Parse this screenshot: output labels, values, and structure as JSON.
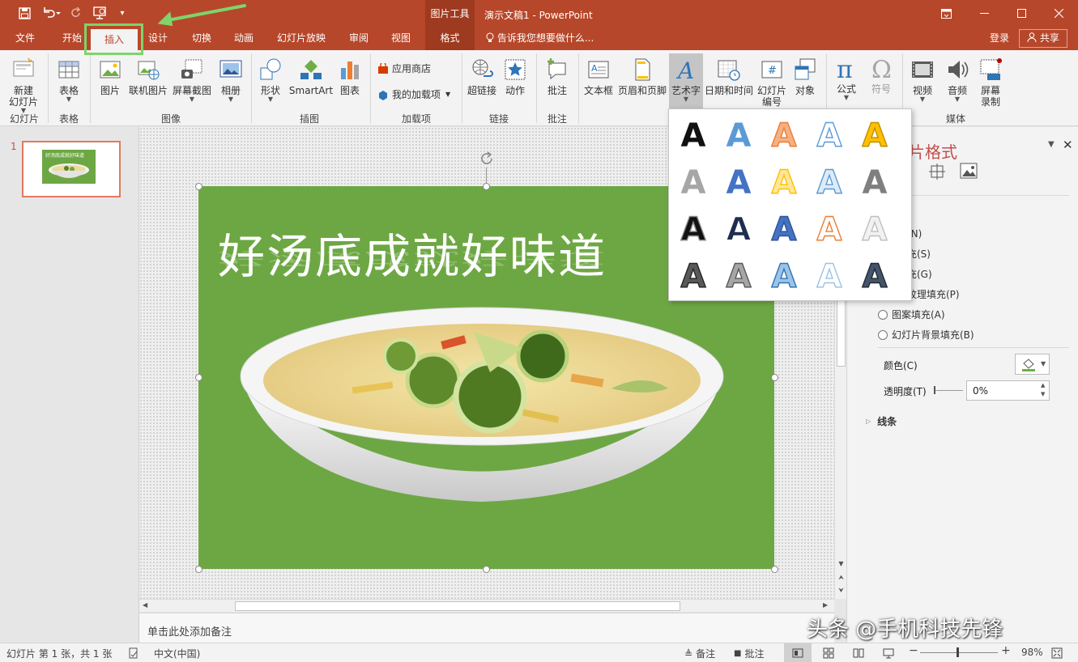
{
  "app": {
    "window_title": "演示文稿1 - PowerPoint",
    "context_tools_header": "图片工具"
  },
  "tabs": [
    {
      "label": "文件"
    },
    {
      "label": "开始"
    },
    {
      "label": "插入"
    },
    {
      "label": "设计"
    },
    {
      "label": "切换"
    },
    {
      "label": "动画"
    },
    {
      "label": "幻灯片放映"
    },
    {
      "label": "审阅"
    },
    {
      "label": "视图"
    },
    {
      "label": "格式"
    }
  ],
  "tellme": "告诉我您想要做什么...",
  "account": {
    "login": "登录",
    "share": "共享"
  },
  "ribbon": {
    "new_slide": "新建\n幻灯片",
    "table": "表格",
    "picture": "图片",
    "online_picture": "联机图片",
    "screenshot": "屏幕截图",
    "album": "相册",
    "shapes": "形状",
    "smartart": "SmartArt",
    "chart": "图表",
    "app_store": "应用商店",
    "my_addins": "我的加载项",
    "hyperlink": "超链接",
    "action": "动作",
    "comment": "批注",
    "textbox": "文本框",
    "header_footer": "页眉和页脚",
    "wordart": "艺术字",
    "datetime": "日期和时间",
    "slide_number": "幻灯片\n编号",
    "object": "对象",
    "equation": "公式",
    "symbol": "符号",
    "video": "视频",
    "audio": "音频",
    "screen_record": "屏幕\n录制",
    "groups": {
      "slides": "幻灯片",
      "tables": "表格",
      "images": "图像",
      "illustrations": "插图",
      "addins": "加载项",
      "links": "链接",
      "comments": "批注",
      "media": "媒体"
    }
  },
  "slide_pane": {
    "number": "1",
    "thumb_title": "好汤底成就好味道"
  },
  "slide": {
    "title": "好汤底成就好味道"
  },
  "notes_placeholder": "单击此处添加备注",
  "format_pane": {
    "title": "片格式",
    "fill_options": [
      "充(N)",
      "填充(S)",
      "填充(G)",
      "或纹理填充(P)",
      "图案填充(A)",
      "幻灯片背景填充(B)"
    ],
    "color_label": "颜色(C)",
    "transparency_label": "透明度(T)",
    "transparency_value": "0%",
    "line_section": "线条"
  },
  "wordart_gallery": {
    "glyph": "A",
    "styles": [
      {
        "fill": "#111111",
        "stroke": "none"
      },
      {
        "fill": "#5b9bd5",
        "stroke": "none"
      },
      {
        "fill": "#f4b183",
        "stroke": "#ed7d31"
      },
      {
        "fill": "#ffffff",
        "stroke": "#5b9bd5"
      },
      {
        "fill": "#ffc000",
        "stroke": "#bf9000"
      },
      {
        "fill": "#a6a6a6",
        "stroke": "none"
      },
      {
        "fill": "#4472c4",
        "stroke": "none"
      },
      {
        "fill": "#ffe699",
        "stroke": "#ffc000"
      },
      {
        "fill": "#deebf7",
        "stroke": "#5b9bd5"
      },
      {
        "fill": "#7f7f7f",
        "stroke": "none"
      },
      {
        "fill": "#111111",
        "stroke": "#888888"
      },
      {
        "fill": "#1f2d4e",
        "stroke": "#ffffff"
      },
      {
        "fill": "#4472c4",
        "stroke": "#2f5597"
      },
      {
        "fill": "#ffffff",
        "stroke": "#ed7d31"
      },
      {
        "fill": "#f2f2f2",
        "stroke": "#bfbfbf"
      },
      {
        "fill": "#595959",
        "stroke": "#262626"
      },
      {
        "fill": "#a6a6a6",
        "stroke": "#595959"
      },
      {
        "fill": "#9dc3e6",
        "stroke": "#2e75b6"
      },
      {
        "fill": "#ffffff",
        "stroke": "#9dc3e6"
      },
      {
        "fill": "#44546a",
        "stroke": "#222a35"
      }
    ]
  },
  "status": {
    "slide_info": "幻灯片 第 1 张，共 1 张",
    "language": "中文(中国)",
    "notes": "备注",
    "comments": "批注",
    "zoom": "98%"
  },
  "watermark": "头条 @手机科技先锋",
  "colors": {
    "accent": "#b7472a",
    "slide_bg": "#6da743",
    "highlight": "#7fd36b",
    "pane_title": "#c0504d"
  }
}
